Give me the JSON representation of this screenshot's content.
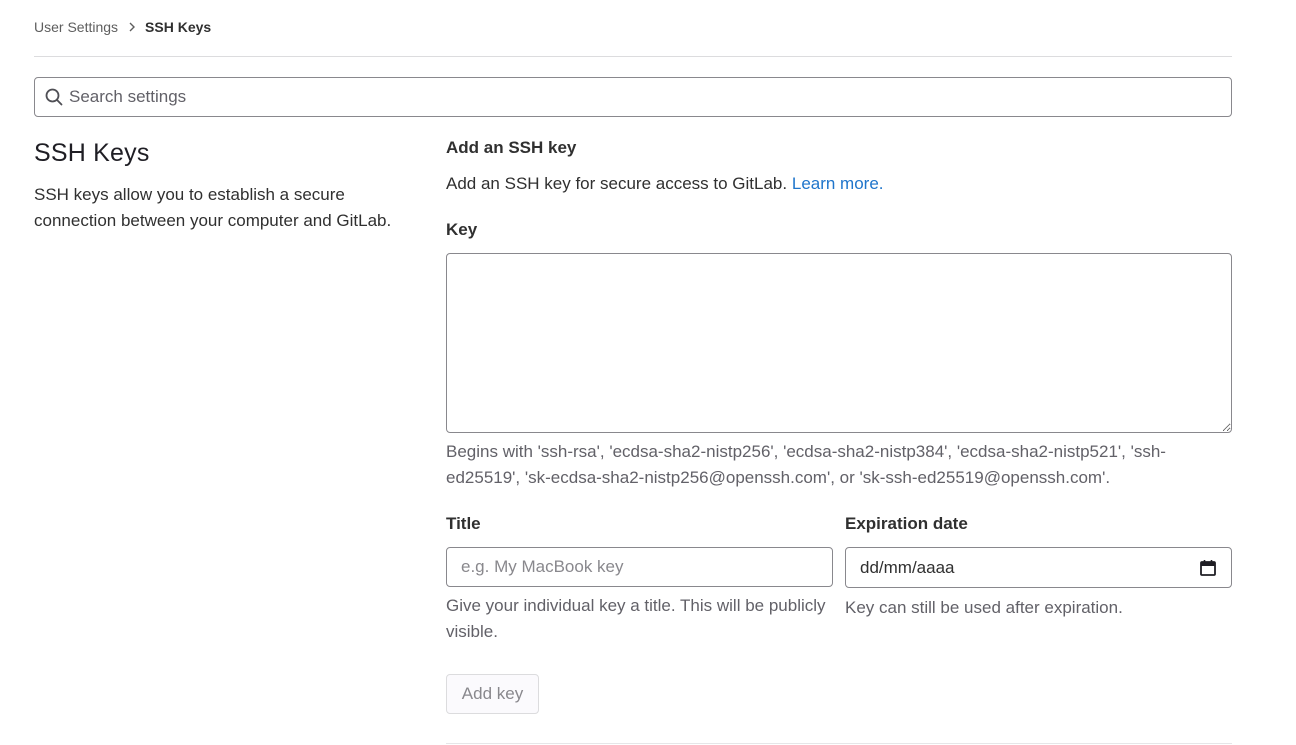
{
  "breadcrumb": {
    "parent": "User Settings",
    "current": "SSH Keys"
  },
  "search": {
    "placeholder": "Search settings",
    "value": ""
  },
  "left": {
    "title": "SSH Keys",
    "description": "SSH keys allow you to establish a secure connection between your computer and GitLab."
  },
  "form": {
    "heading": "Add an SSH key",
    "description": "Add an SSH key for secure access to GitLab.",
    "learn_more": "Learn more.",
    "key_label": "Key",
    "key_value": "",
    "key_help": "Begins with 'ssh-rsa', 'ecdsa-sha2-nistp256', 'ecdsa-sha2-nistp384', 'ecdsa-sha2-nistp521', 'ssh-ed25519', 'sk-ecdsa-sha2-nistp256@openssh.com', or 'sk-ssh-ed25519@openssh.com'.",
    "title_label": "Title",
    "title_placeholder": "e.g. My MacBook key",
    "title_help": "Give your individual key a title. This will be publicly visible.",
    "expiration_label": "Expiration date",
    "expiration_value": "dd/mm/aaaa",
    "expiration_help": "Key can still be used after expiration.",
    "submit_label": "Add key"
  },
  "colors": {
    "link": "#1f75cb",
    "text": "#303030",
    "muted": "#626168",
    "border": "#89888d"
  }
}
